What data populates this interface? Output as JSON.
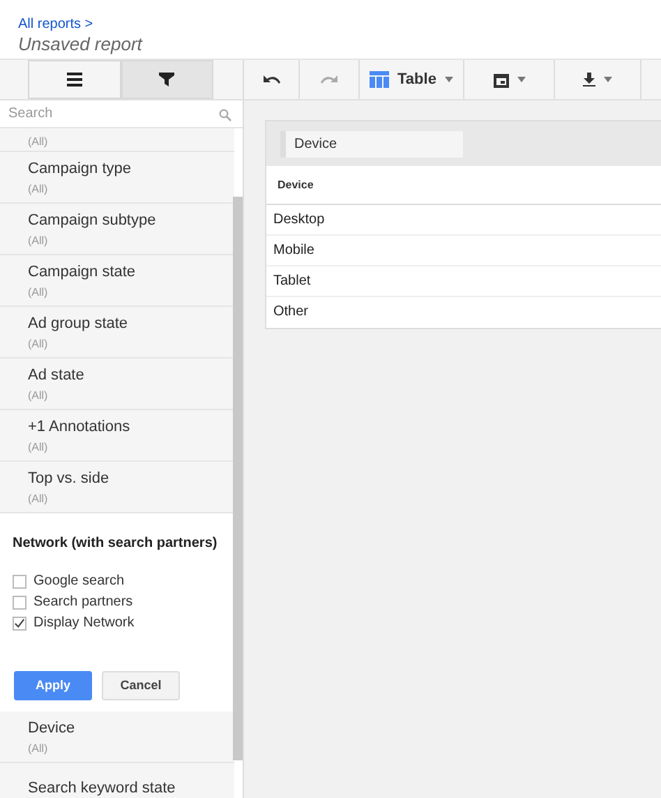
{
  "header": {
    "breadcrumb": "All reports >",
    "title": "Unsaved report"
  },
  "panel_tabs": [
    {
      "kind": "list",
      "selected": false
    },
    {
      "kind": "filter",
      "selected": true
    }
  ],
  "search": {
    "placeholder": "Search"
  },
  "filters_above": [
    {
      "value": "(All)"
    },
    {
      "name": "Campaign type",
      "value": "(All)"
    },
    {
      "name": "Campaign subtype",
      "value": "(All)"
    },
    {
      "name": "Campaign state",
      "value": "(All)"
    },
    {
      "name": "Ad group state",
      "value": "(All)"
    },
    {
      "name": "Ad state",
      "value": "(All)"
    },
    {
      "name": "+1 Annotations",
      "value": "(All)"
    },
    {
      "name": "Top vs. side",
      "value": "(All)"
    }
  ],
  "open_filter": {
    "title": "Network (with search partners)",
    "options": [
      {
        "label": "Google search",
        "checked": false
      },
      {
        "label": "Search partners",
        "checked": false
      },
      {
        "label": "Display Network",
        "checked": true
      }
    ],
    "apply": "Apply",
    "cancel": "Cancel"
  },
  "filters_below": [
    {
      "name": "Device",
      "value": "(All)"
    },
    {
      "name": "Search keyword state"
    }
  ],
  "toolbar": [
    {
      "kind": "undo",
      "disabled": false
    },
    {
      "kind": "redo",
      "disabled": true
    },
    {
      "kind": "table",
      "label": "Table",
      "disabled": false
    },
    {
      "kind": "calendar",
      "disabled": false
    },
    {
      "kind": "download",
      "disabled": false
    }
  ],
  "report": {
    "chip": "Device",
    "columns": [
      "Device"
    ],
    "rows": [
      "Desktop",
      "Mobile",
      "Tablet",
      "Other"
    ]
  }
}
